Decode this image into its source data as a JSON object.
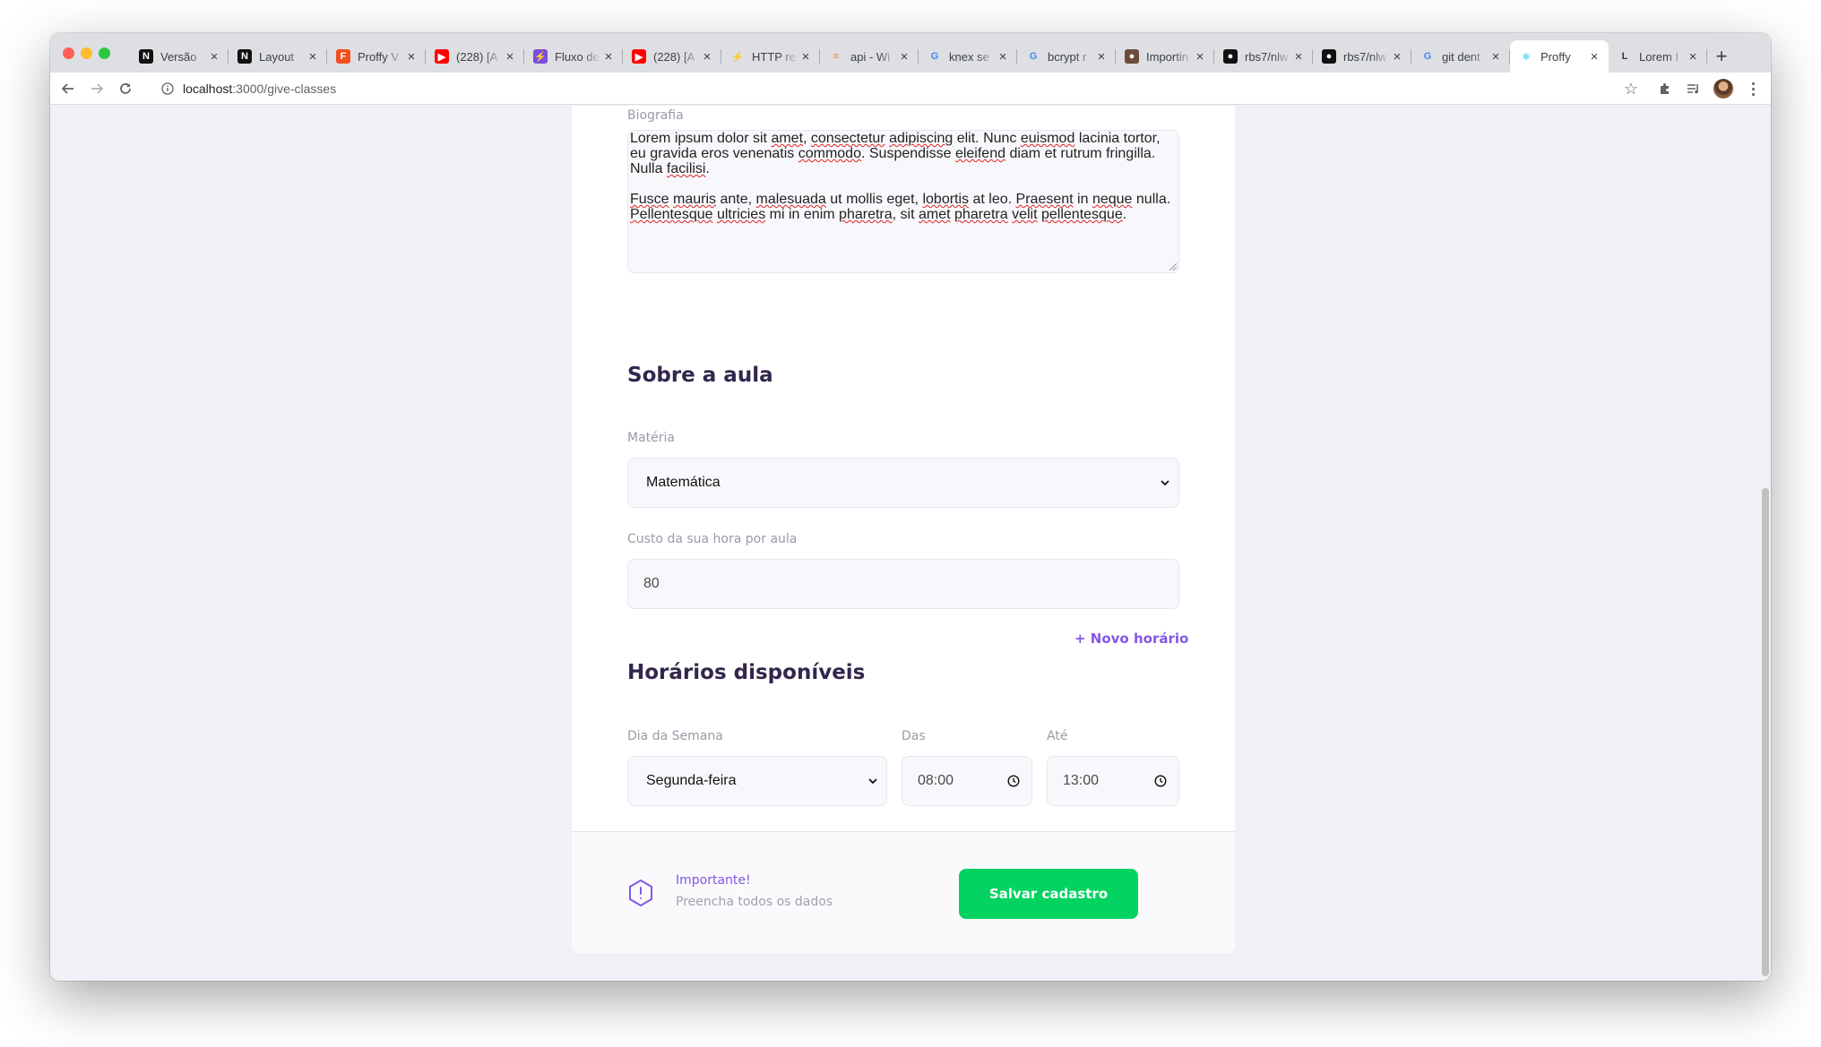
{
  "browser": {
    "tabs": [
      {
        "title": "Versão",
        "icon": "notion-icon",
        "color": "#111111"
      },
      {
        "title": "Layout",
        "icon": "notion-icon",
        "color": "#111111"
      },
      {
        "title": "Proffy V",
        "icon": "figma-icon",
        "color": "#f24e1e"
      },
      {
        "title": "(228) [A",
        "icon": "youtube-icon",
        "color": "#ff0000"
      },
      {
        "title": "Fluxo de",
        "icon": "whimsical-icon",
        "color": "#7b4ce0"
      },
      {
        "title": "(228) [A",
        "icon": "youtube-icon",
        "color": "#ff0000"
      },
      {
        "title": "HTTP re",
        "icon": "bolt-icon",
        "color": "#333333"
      },
      {
        "title": "api - Wi",
        "icon": "stackoverflow-icon",
        "color": "#f48024"
      },
      {
        "title": "knex se",
        "icon": "google-icon",
        "color": "#4285f4"
      },
      {
        "title": "bcrypt r",
        "icon": "google-icon",
        "color": "#4285f4"
      },
      {
        "title": "Importin",
        "icon": "avatar-icon",
        "color": "#6b4b3a"
      },
      {
        "title": "rbs7/nlw",
        "icon": "github-icon",
        "color": "#111111"
      },
      {
        "title": "rbs7/nlw",
        "icon": "github-icon",
        "color": "#111111"
      },
      {
        "title": "git dent",
        "icon": "google-icon",
        "color": "#4285f4"
      },
      {
        "title": "Proffy",
        "icon": "react-icon",
        "color": "#61dafb",
        "active": true
      },
      {
        "title": "Lorem I",
        "icon": "lipsum-icon",
        "color": "#333333"
      }
    ],
    "url_host": "localhost",
    "url_path": ":3000/give-classes"
  },
  "form": {
    "bio_label": "Biografia",
    "bio_paragraphs": [
      "Lorem ipsum dolor sit amet, consectetur adipiscing elit. Nunc euismod lacinia tortor, eu gravida eros venenatis commodo. Suspendisse eleifend diam et rutrum fringilla. Nulla facilisi.",
      "Fusce mauris ante, malesuada ut mollis eget, lobortis at leo. Praesent in neque nulla. Pellentesque ultricies mi in enim pharetra, sit amet pharetra velit pellentesque."
    ],
    "about_title": "Sobre a aula",
    "subject_label": "Matéria",
    "subject_value": "Matemática",
    "cost_label": "Custo da sua hora por aula",
    "cost_value": "80",
    "schedule_title": "Horários disponíveis",
    "new_schedule": "+ Novo horário",
    "weekday_label": "Dia da Semana",
    "weekday_value": "Segunda-feira",
    "from_label": "Das",
    "from_value": "08:00",
    "to_label": "Até",
    "to_value": "13:00"
  },
  "footer": {
    "notice_title": "Importante!",
    "notice_text": "Preencha todos os dados",
    "save_label": "Salvar cadastro"
  },
  "colors": {
    "primary": "#8257e5",
    "secondary": "#04d361",
    "heading": "#32264d",
    "background": "#f0f0f7"
  }
}
